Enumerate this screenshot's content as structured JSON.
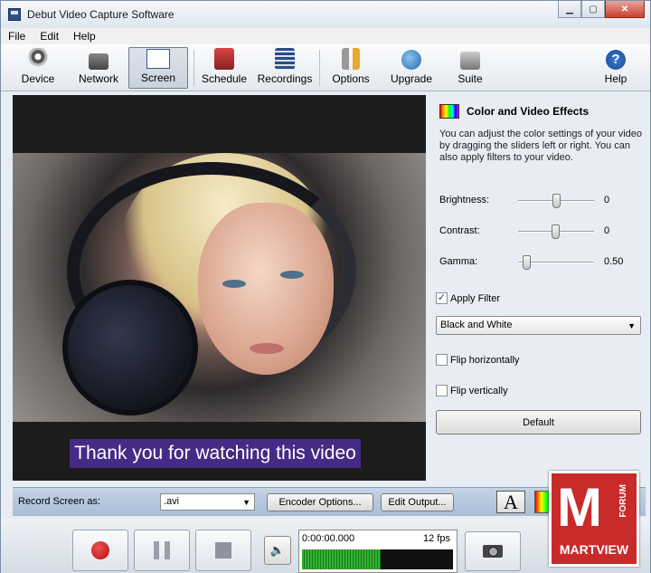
{
  "window": {
    "title": "Debut Video Capture Software"
  },
  "menu": [
    "File",
    "Edit",
    "Help"
  ],
  "toolbar": {
    "device": "Device",
    "network": "Network",
    "screen": "Screen",
    "schedule": "Schedule",
    "recordings": "Recordings",
    "options": "Options",
    "upgrade": "Upgrade",
    "suite": "Suite",
    "help": "Help",
    "active": "Screen"
  },
  "video": {
    "caption": "Thank  you for watching this video"
  },
  "effects": {
    "title": "Color and Video Effects",
    "description": "You can adjust the color settings of your video by dragging the sliders left or right. You can also apply filters to your video.",
    "brightness_label": "Brightness:",
    "brightness_value": "0",
    "contrast_label": "Contrast:",
    "contrast_value": "0",
    "gamma_label": "Gamma:",
    "gamma_value": "0.50",
    "apply_filter_label": "Apply Filter",
    "apply_filter_checked": true,
    "filter_selected": "Black and White",
    "flip_h_label": "Flip horizontally",
    "flip_v_label": "Flip vertically",
    "default_button": "Default"
  },
  "record": {
    "label": "Record Screen as:",
    "format": ".avi",
    "encoder_button": "Encoder Options...",
    "edit_output_button": "Edit Output...",
    "text_button": "A"
  },
  "controls": {
    "time": "0:00:00.000",
    "fps": "12 fps"
  },
  "watermark": {
    "name": "MARTVIEW",
    "forum": "FORUM",
    "letter": "M"
  },
  "colors": {
    "caption_bg": "#452a86",
    "logo_bg": "#c92a2a",
    "record_red": "#c41414"
  }
}
